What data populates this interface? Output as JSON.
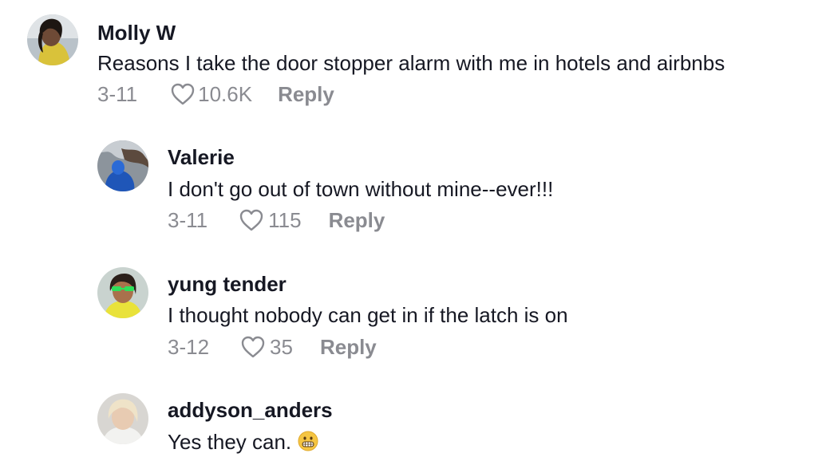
{
  "comments": [
    {
      "username": "Molly W",
      "text": "Reasons I take the door stopper alarm with me in hotels and airbnbs",
      "date": "3-11",
      "likes": "10.6K",
      "reply_label": "Reply",
      "avatar_icon": "user-avatar"
    },
    {
      "username": "Valerie",
      "text": "I don't go out of town without mine--ever!!!",
      "date": "3-11",
      "likes": "115",
      "reply_label": "Reply",
      "avatar_icon": "user-avatar"
    },
    {
      "username": "yung tender",
      "text": "I thought nobody can get in if the latch is on",
      "date": "3-12",
      "likes": "35",
      "reply_label": "Reply",
      "avatar_icon": "user-avatar"
    },
    {
      "username": "addyson_anders",
      "text": "Yes they can.",
      "emoji": "grimacing-face",
      "avatar_icon": "user-avatar"
    }
  ],
  "icons": {
    "like": "heart-outline-icon"
  },
  "colors": {
    "text_primary": "#161823",
    "text_secondary": "#8a8b91",
    "background": "#ffffff"
  }
}
